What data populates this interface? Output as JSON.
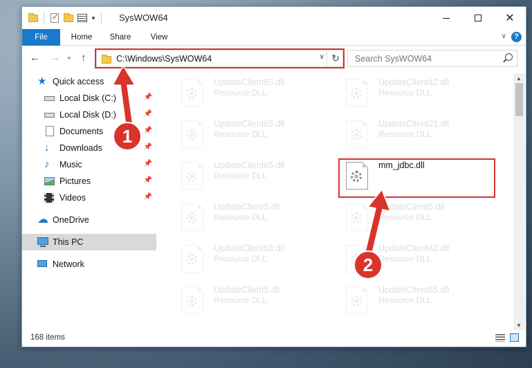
{
  "window": {
    "title": "SysWOW64"
  },
  "ribbon": {
    "tabs": [
      "File",
      "Home",
      "Share",
      "View"
    ]
  },
  "navbar": {
    "address": "C:\\Windows\\SysWOW64",
    "search_placeholder": "Search SysWOW64"
  },
  "navpane": {
    "items": [
      {
        "label": "Quick access",
        "icon": "star-icon"
      },
      {
        "label": "Local Disk (C:)",
        "icon": "drive-icon"
      },
      {
        "label": "Local Disk (D:)",
        "icon": "drive-icon"
      },
      {
        "label": "Documents",
        "icon": "document-icon"
      },
      {
        "label": "Downloads",
        "icon": "download-icon"
      },
      {
        "label": "Music",
        "icon": "music-icon"
      },
      {
        "label": "Pictures",
        "icon": "pictures-icon"
      },
      {
        "label": "Videos",
        "icon": "videos-icon"
      },
      {
        "label": "OneDrive",
        "icon": "cloud-icon"
      },
      {
        "label": "This PC",
        "icon": "computer-icon"
      },
      {
        "label": "Network",
        "icon": "network-icon"
      }
    ]
  },
  "files": [
    {
      "name": "UpdateClient65.dll",
      "type": "Resource DLL"
    },
    {
      "name": "UpdateClient42.dll",
      "type": "Resource DLL"
    },
    {
      "name": "UpdateClient65.dll",
      "type": "Resource DLL"
    },
    {
      "name": "UpdateClient21.dll",
      "type": "Resource DLL"
    },
    {
      "name": "UpdateClient65.dll",
      "type": "Resource DLL"
    },
    {
      "name": "mm_jdbc.dll",
      "type": ""
    },
    {
      "name": "UpdateClient5.dll",
      "type": "Resource DLL"
    },
    {
      "name": "UpdateClient5.dll",
      "type": "Resource DLL"
    },
    {
      "name": "UpdateClient63.dll",
      "type": "Resource DLL"
    },
    {
      "name": "UpdateClient42.dll",
      "type": "Resource DLL"
    },
    {
      "name": "UpdateClient5.dll",
      "type": "Resource DLL"
    },
    {
      "name": "UpdateClient65.dll",
      "type": "Resource DLL"
    }
  ],
  "status": {
    "item_count": "168 items"
  },
  "annotations": {
    "step1": "1",
    "step2": "2",
    "color": "#d9342b"
  }
}
